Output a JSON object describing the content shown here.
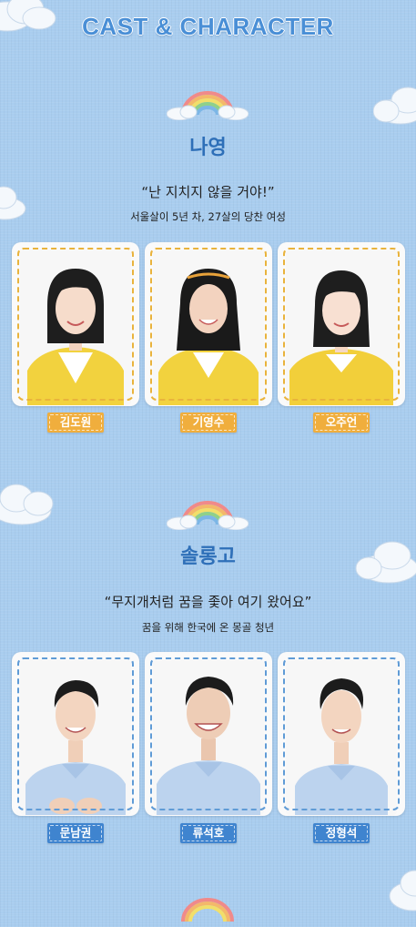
{
  "page": {
    "title": "CAST & CHARACTER"
  },
  "colors": {
    "background": "#a9cdef",
    "title": "#4a8fd6",
    "name": "#2e6fb8",
    "tag_yellow": "#f0ae3d",
    "tag_blue": "#3f84cf"
  },
  "characters": [
    {
      "name": "나영",
      "quote": "“난 지치지 않을 거야!”",
      "desc": "서울살이 5년 차, 27살의 당찬 여성",
      "theme": "yellow",
      "cast": [
        {
          "actor": "김도원",
          "icon": "actress-portrait"
        },
        {
          "actor": "기영수",
          "icon": "actress-portrait"
        },
        {
          "actor": "오주언",
          "icon": "actress-portrait"
        }
      ]
    },
    {
      "name": "솔롱고",
      "quote": "“무지개처럼 꿈을 좇아 여기 왔어요”",
      "desc": "꿈을 위해 한국에 온 몽골 청년",
      "theme": "blue",
      "cast": [
        {
          "actor": "문남권",
          "icon": "actor-portrait"
        },
        {
          "actor": "류석호",
          "icon": "actor-portrait"
        },
        {
          "actor": "정형석",
          "icon": "actor-portrait"
        }
      ]
    }
  ],
  "decor": {
    "cloud_icon": "cloud-icon",
    "rainbow_icon": "rainbow-icon"
  }
}
